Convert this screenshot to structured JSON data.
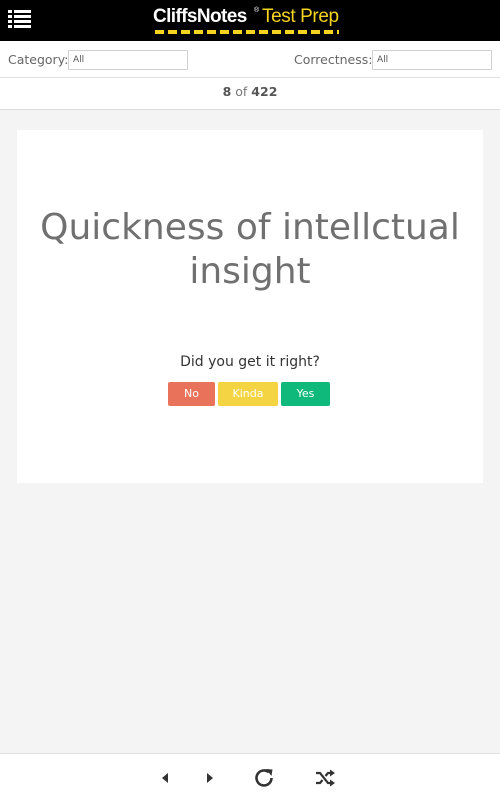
{
  "header": {
    "brand_main": "CliffsNotes",
    "brand_reg": "®",
    "brand_sub": "Test Prep",
    "menu_icon": "menu-list-icon"
  },
  "filters": {
    "category_label": "Category:",
    "category_value": "All",
    "correctness_label": "Correctness:",
    "correctness_value": "All"
  },
  "counter": {
    "current": "8",
    "separator": " of ",
    "total": "422"
  },
  "card": {
    "question": "Quickness of intellctual insight",
    "prompt": "Did you get it right?",
    "buttons": {
      "no": "No",
      "kinda": "Kinda",
      "yes": "Yes"
    }
  },
  "footer": {
    "icons": [
      "previous-icon",
      "next-icon",
      "refresh-icon",
      "shuffle-icon"
    ]
  },
  "colors": {
    "header_bg": "#000000",
    "brand_yellow": "#f5d31f",
    "no": "#e8735a",
    "kinda": "#f5d443",
    "yes": "#0fb97c"
  }
}
